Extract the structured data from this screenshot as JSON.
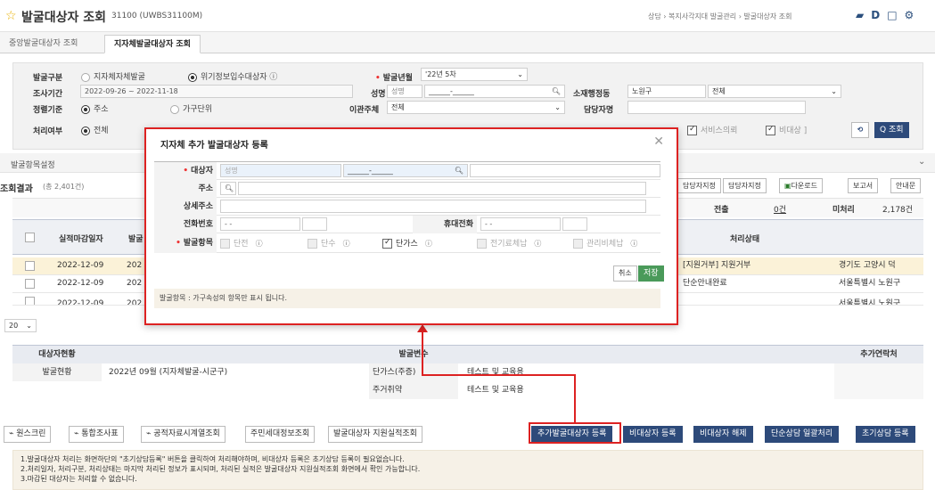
{
  "header": {
    "title": "발굴대상자 조회",
    "code": "31100 (UWBS31100M)",
    "breadcrumb": "상담 › 복지사각지대 발굴관리 › 발굴대상자 조회",
    "icons": [
      "bookmark-icon",
      "help-icon",
      "window-icon",
      "settings-icon"
    ]
  },
  "tabs": [
    {
      "label": "중앙발굴대상자 조회"
    },
    {
      "label": "지자체발굴대상자 조회"
    }
  ],
  "search": {
    "gubun_label": "발굴구분",
    "gubun_opt1": "지자체자체발굴",
    "gubun_opt2": "위기정보입수대상자 ⓘ",
    "period_label": "조사기간",
    "period_value": "2022-09-26 ~ 2022-11-18",
    "sort_label": "정렬기준",
    "sort_opt1": "주소",
    "sort_opt2": "가구단위",
    "proc_label": "처리여부",
    "proc_opt1": "전체",
    "ym_label": "발굴년월",
    "ym_value": "'22년 5차",
    "name_label": "성명",
    "name_placeholder": "성명",
    "name_id": "______-______",
    "tr_label": "이관주체",
    "tr_value": "전체",
    "region_label": "소재행정동",
    "region_value1": "노원구",
    "region_value2": "전체",
    "mgr_label": "담당자명",
    "service_chk": "서비스의뢰",
    "nontarget_chk": "비대상 ]",
    "search_btn": "Q 조회"
  },
  "section": {
    "label": "발굴항목설정"
  },
  "result": {
    "title": "조회결과",
    "count": "(총 2,401건)",
    "btns": [
      "담당자지정",
      "담당자지정",
      "다운로드",
      "보고서",
      "안내문"
    ],
    "sum1_label": "전출",
    "sum1_val": "0건",
    "sum2_label": "미처리",
    "sum2_val": "2,178건"
  },
  "grid": {
    "headers": [
      "실적마감일자",
      "발굴",
      "",
      "처리상태"
    ],
    "rows": [
      {
        "date": "2022-12-09",
        "cut": "202",
        "status": "[지원거부] 지원거부",
        "addr": "경기도 고양시 덕"
      },
      {
        "date": "2022-12-09",
        "cut": "202",
        "status": "단순안내완료",
        "addr": "서울특별시 노원구"
      },
      {
        "date": "2022-12-09",
        "cut": "202",
        "status": "",
        "addr": "서울특별시 노원구"
      }
    ],
    "page_size": "20"
  },
  "bottom": {
    "h1": "대상자현황",
    "h2": "발굴변수",
    "h3": "추가연락처",
    "r1_label": "발굴현황",
    "r1_value": "2022년 09월 (지자체발굴-시군구)",
    "v1_label": "단가스(주증)",
    "v1_value": "테스트 및 교육용",
    "v2_label": "주거취약",
    "v2_value": "테스트 및 교육용"
  },
  "actions": {
    "left": [
      "원스크린",
      "통합조사표",
      "공적자료시계열조회",
      "주민세대정보조회",
      "발굴대상자 지원실적조회"
    ],
    "add_btn": "추가발굴대상자 등록",
    "nontarget_btn": "비대상자 등록",
    "release_btn": "비대상자 해제",
    "simple_btn": "단순상담 일괄처리",
    "initial_btn": "초기상담 등록"
  },
  "notes": {
    "n1": "1.발굴대상자 처리는 화면하단의 \"초기상담등록\" 버튼을 클릭하여 처리해야하며, 비대상자 등록은 초기상담 등록이 필요없습니다.",
    "n2": "2.처리일자, 처리구분, 처리상태는 마지막 처리된 정보가 표시되며, 처리된 실적은 발굴대상자 지원실적조회 화면에서 확인 가능합니다.",
    "n3": "3.마감된 대상자는 처리할 수 없습니다."
  },
  "modal": {
    "title": "지자체 추가 발굴대상자 등록",
    "target_label": "대상자",
    "target_placeholder": "성명",
    "target_id": "______-______",
    "addr_label": "주소",
    "addr_detail_label": "상세주소",
    "phone_label": "전화번호",
    "phone_value": "-     -",
    "mobile_label": "휴대전화",
    "mobile_value": "-     -",
    "items_label": "발굴항목",
    "item1": "단전",
    "item2": "단수",
    "item3": "단가스",
    "item4": "전기료체납",
    "item5": "관리비체납",
    "cancel": "취소",
    "save": "저장",
    "note": "발굴항목 : 가구속성의 항목만 표시 됩니다."
  },
  "colors": {
    "accent": "#2d4a7a",
    "highlight": "#d22222",
    "row_selected": "#fbf2d8"
  }
}
